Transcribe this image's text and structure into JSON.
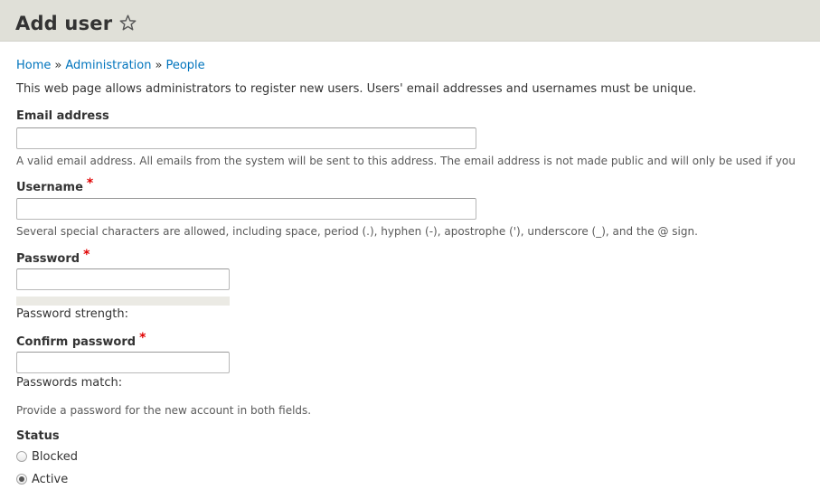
{
  "header": {
    "title": "Add user",
    "shortcut_icon": "star-outline-icon"
  },
  "breadcrumb": {
    "items": [
      "Home",
      "Administration",
      "People"
    ],
    "separator": "»"
  },
  "intro": "This web page allows administrators to register new users. Users' email addresses and usernames must be unique.",
  "email": {
    "label": "Email address",
    "value": "",
    "description": "A valid email address. All emails from the system will be sent to this address. The email address is not made public and will only be used if you"
  },
  "username": {
    "label": "Username",
    "required_mark": "*",
    "value": "",
    "description": "Several special characters are allowed, including space, period (.), hyphen (-), apostrophe ('), underscore (_), and the @ sign."
  },
  "password": {
    "label": "Password",
    "required_mark": "*",
    "value": "",
    "strength_label": "Password strength:",
    "strength_fraction": 0
  },
  "confirm_password": {
    "label": "Confirm password",
    "required_mark": "*",
    "value": "",
    "match_label": "Passwords match:",
    "description": "Provide a password for the new account in both fields."
  },
  "status": {
    "label": "Status",
    "options": [
      {
        "label": "Blocked",
        "checked": false
      },
      {
        "label": "Active",
        "checked": true
      }
    ]
  },
  "colors": {
    "header_bg": "#e0e0d8",
    "link": "#0074bd",
    "required": "#e00000"
  }
}
